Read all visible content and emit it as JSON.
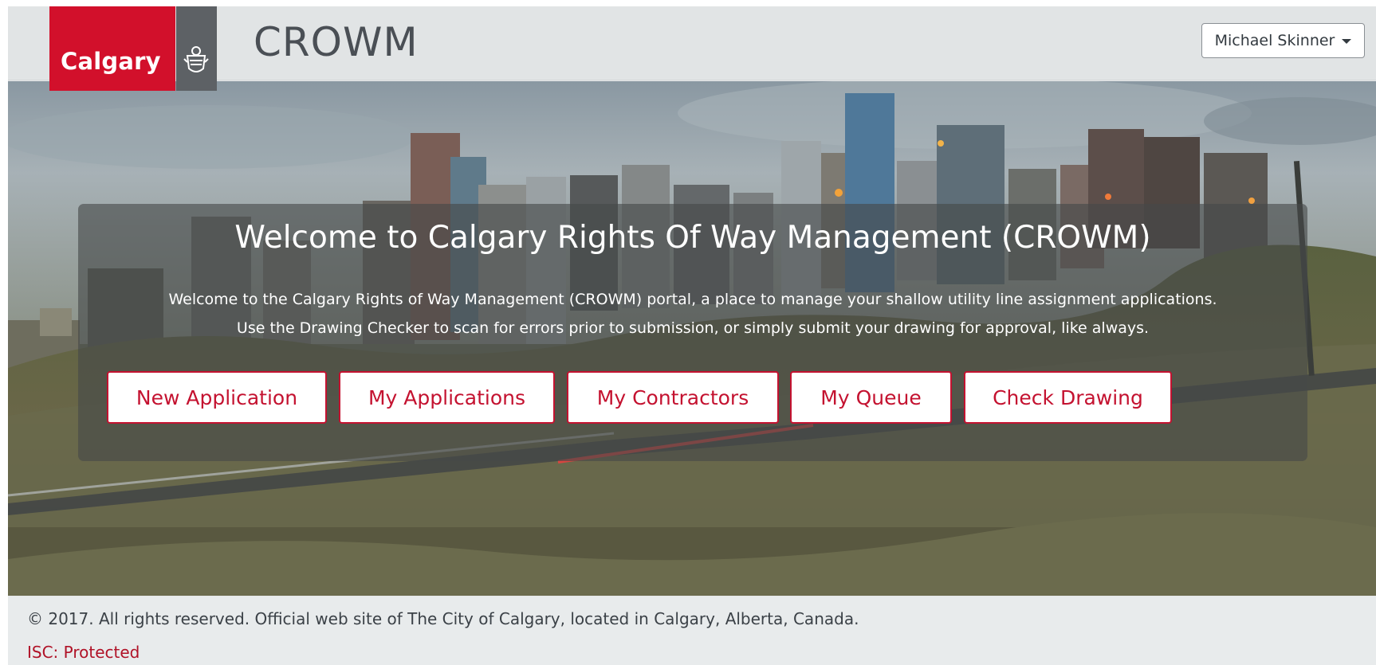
{
  "header": {
    "logo_text": "Calgary",
    "app_title": "CROWM",
    "user_menu_label": "Michael Skinner"
  },
  "welcome": {
    "heading": "Welcome to Calgary Rights Of Way Management (CROWM)",
    "line1": "Welcome to the Calgary Rights of Way Management (CROWM) portal, a place to manage your shallow utility line assignment applications.",
    "line2": "Use the Drawing Checker to scan for errors prior to submission, or simply submit your drawing for approval, like always."
  },
  "actions": [
    {
      "label": "New Application"
    },
    {
      "label": "My Applications"
    },
    {
      "label": "My Contractors"
    },
    {
      "label": "My Queue"
    },
    {
      "label": "Check Drawing"
    }
  ],
  "footer": {
    "copyright": "© 2017. All rights reserved. Official web site of The City of Calgary, located in Calgary, Alberta, Canada.",
    "classification": "ISC: Protected"
  },
  "colors": {
    "brand_red": "#d2102b",
    "button_text": "#c41230",
    "logo_gray": "#5d6165"
  },
  "icons": {
    "crest": "city-crest-icon",
    "dropdown": "caret-down-icon"
  }
}
